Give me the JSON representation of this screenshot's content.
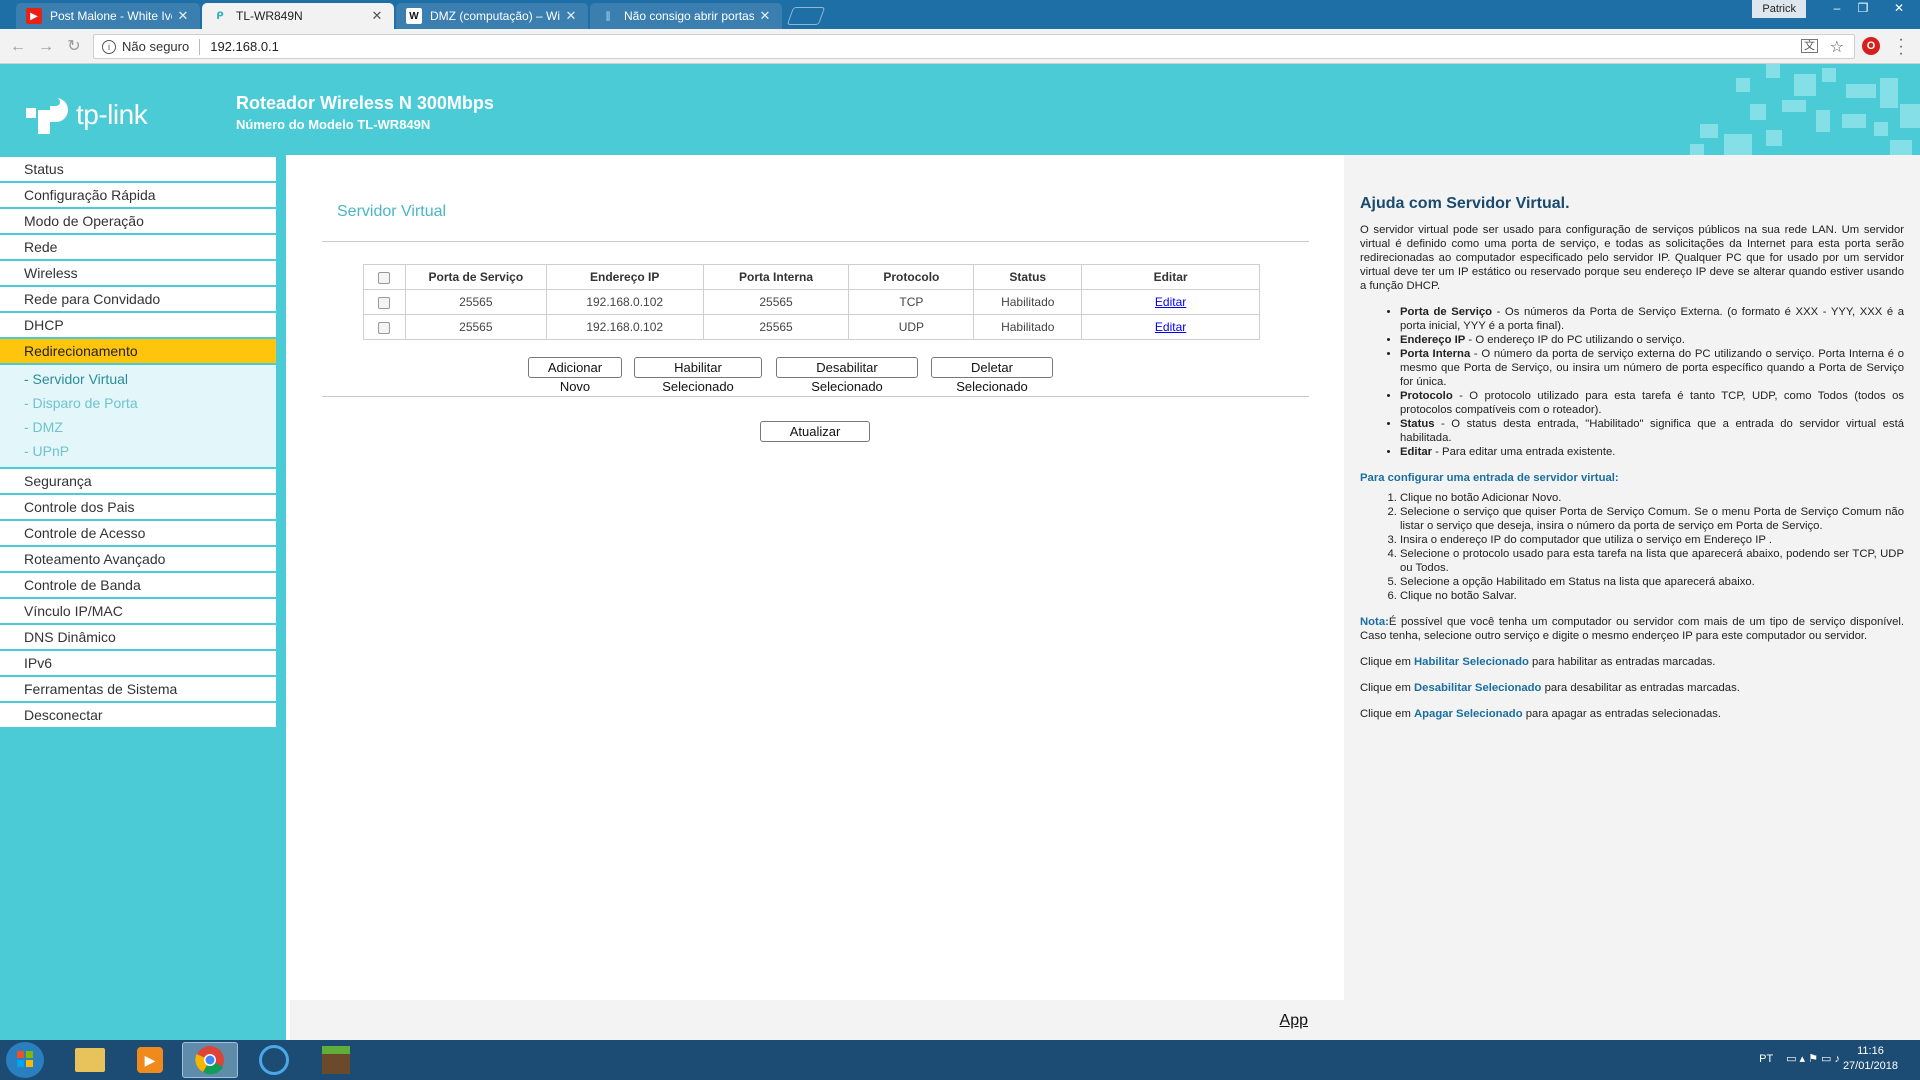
{
  "browser": {
    "tabs": [
      {
        "title": "Post Malone - White Iver",
        "favicon": "youtube-icon"
      },
      {
        "title": "TL-WR849N",
        "favicon": "tplink-icon"
      },
      {
        "title": "DMZ (computação) – Wi",
        "favicon": "wikipedia-icon"
      },
      {
        "title": "Não consigo abrir portas",
        "favicon": "generic-page-icon"
      }
    ],
    "user": "Patrick",
    "security_label": "Não seguro",
    "url": "192.168.0.1"
  },
  "header": {
    "brand": "tp-link",
    "title": "Roteador Wireless N 300Mbps",
    "model": "Número do Modelo TL-WR849N"
  },
  "menu": {
    "items_top": [
      "Status",
      "Configuração Rápida",
      "Modo de Operação",
      "Rede",
      "Wireless",
      "Rede para Convidado",
      "DHCP"
    ],
    "active": "Redirecionamento",
    "sub_items": [
      "- Servidor Virtual",
      "- Disparo de Porta",
      "- DMZ",
      "- UPnP"
    ],
    "items_bottom": [
      "Segurança",
      "Controle dos Pais",
      "Controle de Acesso",
      "Roteamento Avançado",
      "Controle de Banda",
      "Vínculo IP/MAC",
      "DNS Dinâmico",
      "IPv6",
      "Ferramentas de Sistema",
      "Desconectar"
    ]
  },
  "main": {
    "title": "Servidor Virtual",
    "columns": [
      "Porta de Serviço",
      "Endereço IP",
      "Porta Interna",
      "Protocolo",
      "Status",
      "Editar"
    ],
    "rows": [
      {
        "porta": "25565",
        "ip": "192.168.0.102",
        "interna": "25565",
        "protocolo": "TCP",
        "status": "Habilitado",
        "editar": "Editar"
      },
      {
        "porta": "25565",
        "ip": "192.168.0.102",
        "interna": "25565",
        "protocolo": "UDP",
        "status": "Habilitado",
        "editar": "Editar"
      }
    ],
    "buttons": {
      "add": "Adicionar Novo",
      "enable": "Habilitar Selecionado",
      "disable": "Desabilitar Selecionado",
      "delete": "Deletar Selecionado",
      "refresh": "Atualizar"
    },
    "app_link": "App"
  },
  "help": {
    "title": "Ajuda com Servidor Virtual.",
    "intro": "O servidor virtual pode ser usado para configuração de serviços públicos na sua rede LAN. Um servidor virtual é definido como uma porta de serviço, e todas as solicitações da Internet para esta porta serão redirecionadas ao computador especificado pelo servidor IP. Qualquer PC que for usado por um servidor virtual deve ter um IP estático ou reservado porque seu endereço IP deve se alterar quando estiver usando a função DHCP.",
    "fields": [
      {
        "term": "Porta de Serviço",
        "desc": " - Os números da Porta de Serviço Externa. (o formato é XXX - YYY, XXX é a porta inicial, YYY é a porta final)."
      },
      {
        "term": "Endereço IP",
        "desc": " - O endereço IP do PC utilizando o serviço."
      },
      {
        "term": "Porta Interna",
        "desc": " - O número da porta de serviço externa do PC utilizando o serviço. Porta Interna é o mesmo que Porta de Serviço, ou insira um número de porta específico quando a Porta de Serviço for única."
      },
      {
        "term": "Protocolo",
        "desc": " - O protocolo utilizado para esta tarefa é tanto TCP, UDP, como Todos (todos os protocolos compatíveis com o roteador)."
      },
      {
        "term": "Status",
        "desc": " - O status desta entrada, \"Habilitado\" significa que a entrada do servidor virtual está habilitada."
      },
      {
        "term": "Editar",
        "desc": " - Para editar uma entrada existente."
      }
    ],
    "steps_title": "Para configurar uma entrada de servidor virtual:",
    "steps": [
      "Clique no botão Adicionar Novo.",
      "Selecione o serviço que quiser Porta de Serviço Comum. Se o menu Porta de Serviço Comum não listar o serviço que deseja, insira o número da porta de serviço em Porta de Serviço.",
      "Insira o endereço IP do computador que utiliza o serviço em Endereço IP .",
      "Selecione o protocolo usado para esta tarefa na lista que aparecerá abaixo, podendo ser TCP, UDP ou Todos.",
      "Selecione a opção Habilitado em Status na lista que aparecerá abaixo.",
      "Clique no botão Salvar."
    ],
    "note_label": "Nota:",
    "note": "É possível que você tenha um computador ou servidor com mais de um tipo de serviço disponível. Caso tenha, selecione outro serviço e digite o mesmo enderçeo IP para este computador ou servidor.",
    "click_prefix": "Clique em ",
    "enable_term": "Habilitar Selecionado",
    "enable_suffix": " para habilitar as entradas marcadas.",
    "disable_term": "Desabilitar Selecionado",
    "disable_suffix": " para desabilitar as entradas marcadas.",
    "delete_term": "Apagar Selecionado",
    "delete_suffix": " para apagar as entradas selecionadas."
  },
  "taskbar": {
    "lang": "PT",
    "time": "11:16",
    "date": "27/01/2018"
  },
  "colors": {
    "brand_teal": "#4acbd6",
    "menu_active": "#ffc50d",
    "help_title": "#1a4a6e"
  }
}
